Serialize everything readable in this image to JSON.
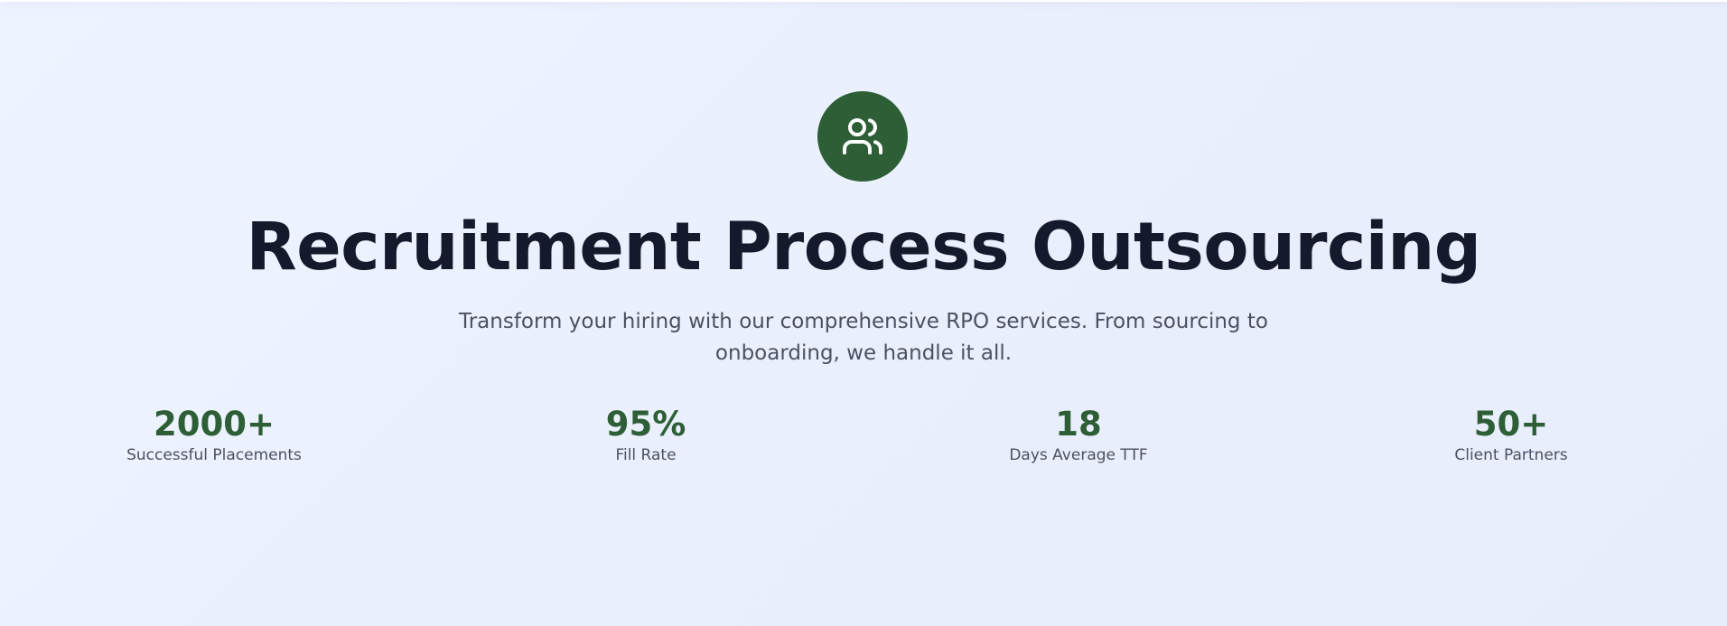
{
  "theme": {
    "accent": "#2d5e36"
  },
  "hero": {
    "icon": "users-icon",
    "title": "Recruitment Process Outsourcing",
    "subtitle": "Transform your hiring with our comprehensive RPO services. From sourcing to onboarding, we handle it all."
  },
  "stats": [
    {
      "value": "2000+",
      "label": "Successful Placements"
    },
    {
      "value": "95%",
      "label": "Fill Rate"
    },
    {
      "value": "18",
      "label": "Days Average TTF"
    },
    {
      "value": "50+",
      "label": "Client Partners"
    }
  ]
}
